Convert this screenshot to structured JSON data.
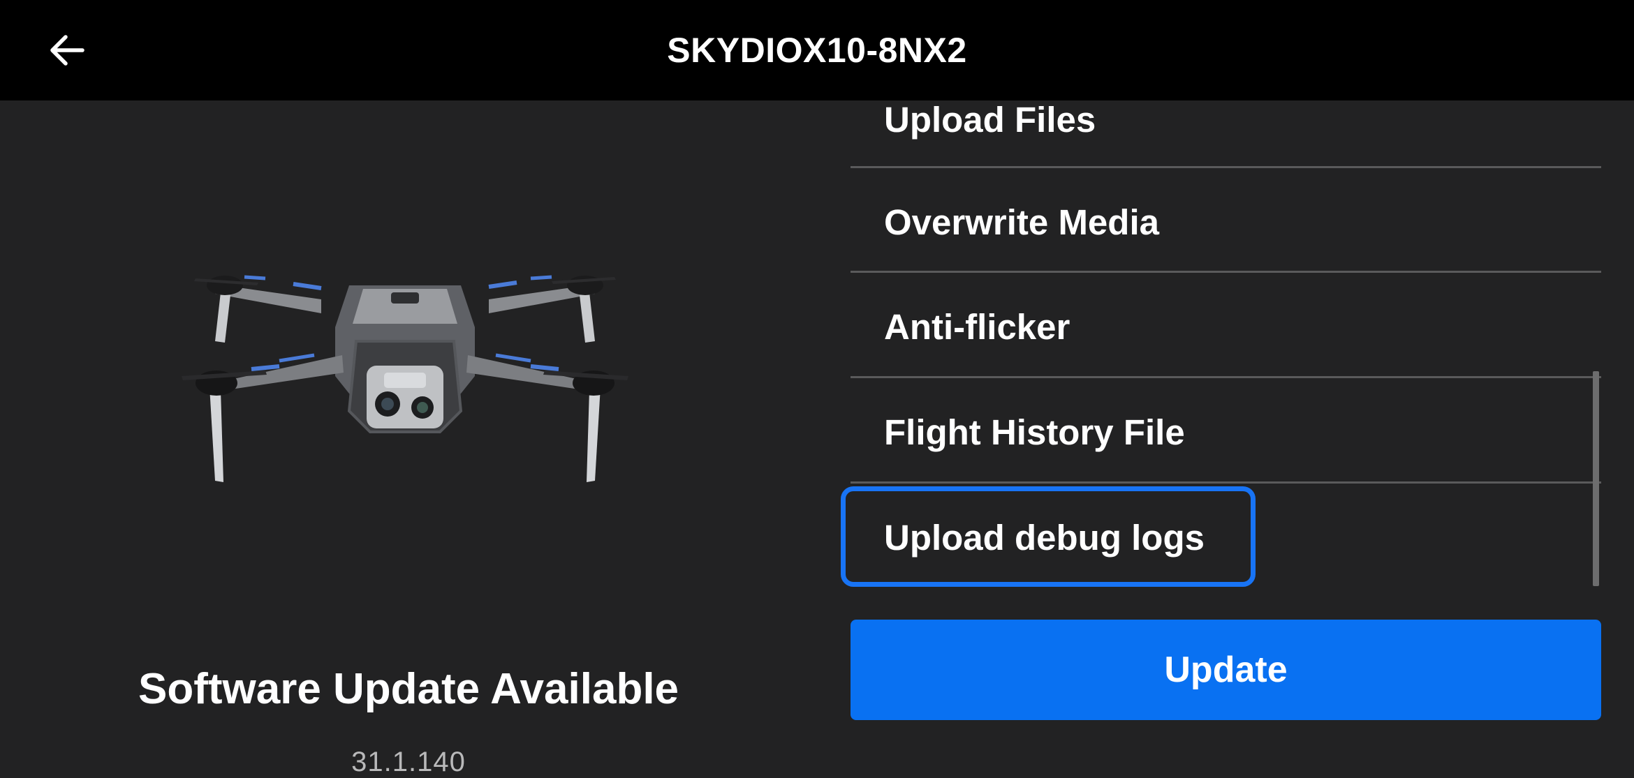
{
  "header": {
    "title": "SKYDIOX10-8NX2",
    "back_icon": "arrow-left-icon"
  },
  "device_panel": {
    "image": "drone-image",
    "update_title": "Software Update Available",
    "version": "31.1.140"
  },
  "menu": {
    "items": [
      {
        "label": "Upload Files"
      },
      {
        "label": "Overwrite Media"
      },
      {
        "label": "Anti-flicker"
      },
      {
        "label": "Flight History File"
      },
      {
        "label": "Upload debug logs",
        "focused": true
      }
    ]
  },
  "actions": {
    "update_label": "Update"
  },
  "colors": {
    "background": "#222223",
    "header": "#000000",
    "accent": "#0971f2",
    "focus_ring": "#1874f5",
    "divider": "#5a5a5b",
    "version_text": "#b9b9ba"
  }
}
